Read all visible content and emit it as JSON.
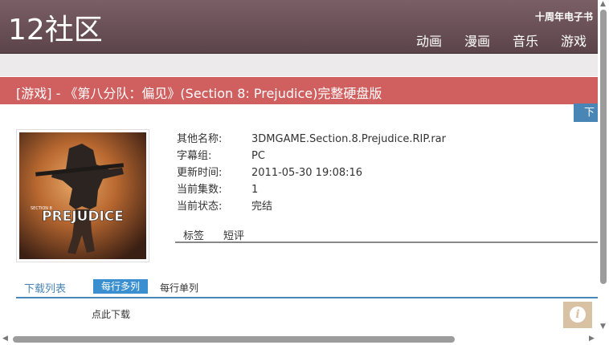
{
  "header": {
    "logo": "12社区",
    "ebook_link": "十周年电子书",
    "nav": [
      "动画",
      "漫画",
      "音乐",
      "游戏"
    ]
  },
  "title_bar": {
    "title": "[游戏] - 《第八分队：偏见》(Section 8: Prejudice)完整硬盘版"
  },
  "download_button": {
    "label": "下载"
  },
  "cover": {
    "game_title_text": "PREJUDICE",
    "series_text": "SECTION 8"
  },
  "info": {
    "rows": [
      {
        "key": "其他名称:",
        "value": "3DMGAME.Section.8.Prejudice.RIP.rar"
      },
      {
        "key": "字幕组:",
        "value": "PC"
      },
      {
        "key": "更新时间:",
        "value": "2011-05-30 19:08:16"
      },
      {
        "key": "当前集数:",
        "value": "1"
      },
      {
        "key": "当前状态:",
        "value": "完结"
      }
    ]
  },
  "tabs": [
    "标签",
    "短评"
  ],
  "download_list": {
    "title": "下载列表",
    "mode_multi": "每行多列",
    "mode_single": "每行单列",
    "link": "点此下载"
  },
  "info_button": {
    "icon": "info-icon"
  },
  "colors": {
    "header_bg": "#6b5157",
    "title_bar": "#d05f5f",
    "accent_blue": "#4a86b5",
    "info_button": "#d8c2a3"
  }
}
